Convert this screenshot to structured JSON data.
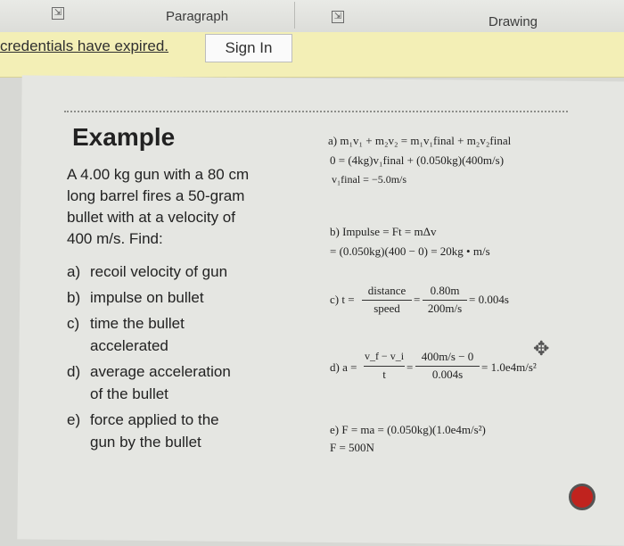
{
  "ribbon": {
    "group1_label": "Paragraph",
    "group2_label": "Drawing"
  },
  "message_bar": {
    "text": "credentials have expired.",
    "button": "Sign In"
  },
  "slide": {
    "title": "Example",
    "problem": [
      "A 4.00 kg gun with a 80 cm",
      "long barrel fires a 50-gram",
      "bullet with at a velocity of",
      "400 m/s. Find:"
    ],
    "items": [
      {
        "letter": "a)",
        "lines": [
          "recoil velocity of gun"
        ]
      },
      {
        "letter": "b)",
        "lines": [
          "impulse on bullet"
        ]
      },
      {
        "letter": "c)",
        "lines": [
          "time the bullet",
          "accelerated"
        ]
      },
      {
        "letter": "d)",
        "lines": [
          "average acceleration",
          "of the bullet"
        ]
      },
      {
        "letter": "e)",
        "lines": [
          "force applied to the",
          "gun by the bullet"
        ]
      }
    ],
    "solutions": {
      "a1": "a) m₁v₁ + m₂v₂ = m₁v₁final + m₂v₂final",
      "a2": "0 = (4kg)v₁final + (0.050kg)(400m/s)",
      "a3": "v₁final = −5.0m/s",
      "b1": "b) Impulse = Ft = mΔv",
      "b2": "= (0.050kg)(400 − 0) = 20kg • m/s",
      "c_prefix": "c) t =",
      "c_num1": "distance",
      "c_den1": "speed",
      "c_eq": "=",
      "c_num2": "0.80m",
      "c_den2": "200m/s",
      "c_result": "= 0.004s",
      "d_prefix": "d) a =",
      "d_num1": "v_f − v_i",
      "d_den1": "t",
      "d_eq": "=",
      "d_num2": "400m/s − 0",
      "d_den2": "0.004s",
      "d_result": "= 1.0e4m/s²",
      "e1": "e) F = ma = (0.050kg)(1.0e4m/s²)",
      "e2": "F = 500N"
    }
  }
}
